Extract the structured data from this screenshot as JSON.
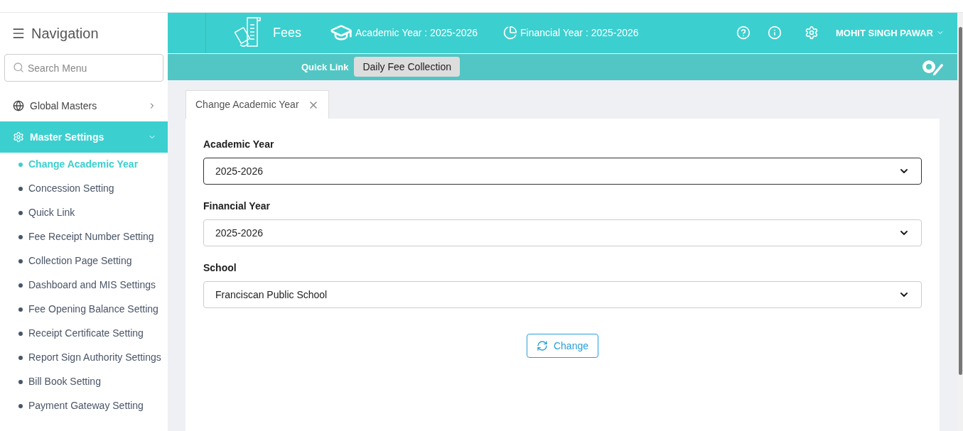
{
  "sidebar": {
    "title": "Navigation",
    "search": {
      "placeholder": "Search Menu"
    },
    "groups": [
      {
        "label": "Global Masters",
        "expanded": false,
        "selected": false,
        "kind": "globe"
      },
      {
        "label": "Master Settings",
        "expanded": true,
        "selected": true,
        "kind": "gear",
        "children": [
          {
            "label": "Change Academic Year",
            "selected": true
          },
          {
            "label": "Concession Setting",
            "selected": false
          },
          {
            "label": "Quick Link",
            "selected": false
          },
          {
            "label": "Fee Receipt Number Setting",
            "selected": false
          },
          {
            "label": "Collection Page Setting",
            "selected": false
          },
          {
            "label": "Dashboard and MIS Settings",
            "selected": false
          },
          {
            "label": "Fee Opening Balance Setting",
            "selected": false
          },
          {
            "label": "Receipt Certificate Setting",
            "selected": false
          },
          {
            "label": "Report Sign Authority Settings",
            "selected": false
          },
          {
            "label": "Bill Book Setting",
            "selected": false
          },
          {
            "label": "Payment Gateway Setting",
            "selected": false
          }
        ]
      }
    ]
  },
  "header": {
    "module": "Fees",
    "academic_year": "Academic Year : 2025-2026",
    "financial_year": "Financial Year : 2025-2026",
    "user": "MOHIT SINGH PAWAR"
  },
  "quick_link": {
    "label": "Quick Link",
    "button": "Daily Fee Collection"
  },
  "tabs": [
    {
      "label": "Change Academic Year",
      "selected": true
    }
  ],
  "form": {
    "fields": [
      {
        "label": "Academic Year",
        "value": "2025-2026",
        "focused": true
      },
      {
        "label": "Financial Year",
        "value": "2025-2026",
        "focused": false
      },
      {
        "label": "School",
        "value": "Franciscan Public School",
        "focused": false
      }
    ],
    "button": "Change"
  }
}
